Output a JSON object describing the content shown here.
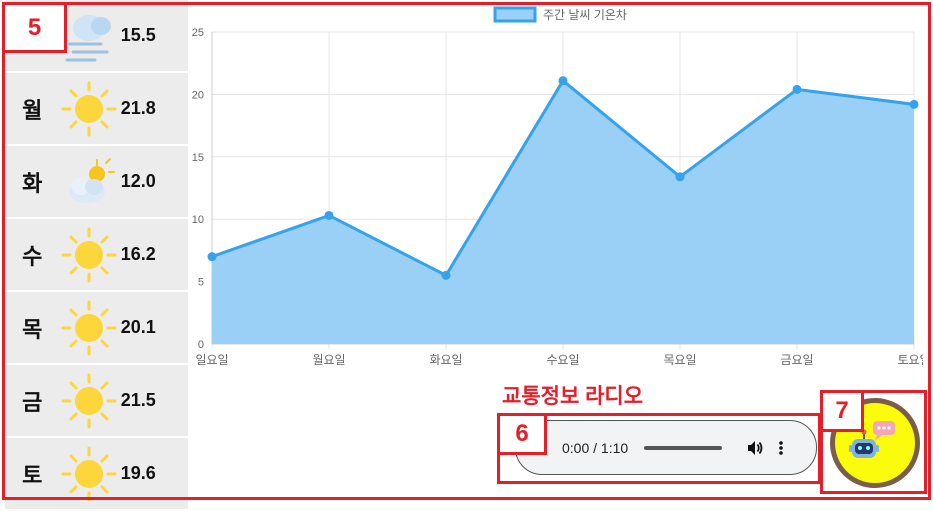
{
  "callouts": {
    "weather": "5",
    "audio": "6",
    "chatbot": "7"
  },
  "forecast": [
    {
      "day": "",
      "icon": "wind-cloud-icon",
      "temp": "15.5"
    },
    {
      "day": "월",
      "icon": "sun-icon",
      "temp": "21.8"
    },
    {
      "day": "화",
      "icon": "partly-cloudy-icon",
      "temp": "12.0"
    },
    {
      "day": "수",
      "icon": "sun-icon",
      "temp": "16.2"
    },
    {
      "day": "목",
      "icon": "sun-icon",
      "temp": "20.1"
    },
    {
      "day": "금",
      "icon": "sun-icon",
      "temp": "21.5"
    },
    {
      "day": "토",
      "icon": "sun-icon",
      "temp": "19.6"
    }
  ],
  "chart_data": {
    "type": "area",
    "legend": "주간 날씨 기온차",
    "legend_position": "top",
    "categories": [
      "일요일",
      "월요일",
      "화요일",
      "수요일",
      "목요일",
      "금요일",
      "토요일"
    ],
    "series": [
      {
        "name": "주간 날씨 기온차",
        "values": [
          7.0,
          10.3,
          5.5,
          21.1,
          13.4,
          20.4,
          19.2
        ]
      }
    ],
    "ylim": [
      0,
      25
    ],
    "yticks": [
      0,
      5,
      10,
      15,
      20,
      25
    ],
    "grid": true,
    "colors": {
      "line": "#36a2eb",
      "fill": "#9ad0f5"
    }
  },
  "audio": {
    "label": "교통정보 라디오",
    "time": "0:00 / 1:10"
  },
  "colors": {
    "accent_red": "#e3202a",
    "chatbot_yellow": "#fbfb0c"
  }
}
